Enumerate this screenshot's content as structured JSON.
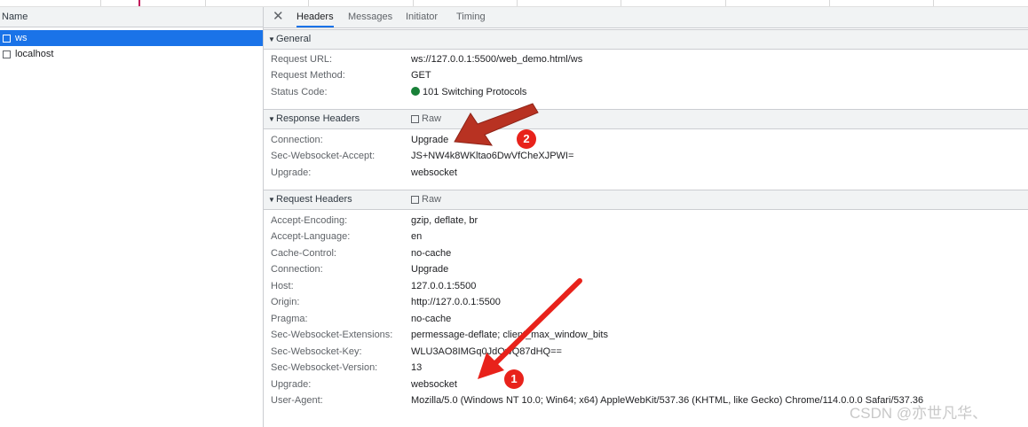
{
  "request_list": {
    "column_header": "Name",
    "items": [
      {
        "name": "ws",
        "selected": true
      },
      {
        "name": "localhost",
        "selected": false
      }
    ]
  },
  "details": {
    "close_icon": "close-icon",
    "tabs": [
      {
        "label": "Headers",
        "active": true
      },
      {
        "label": "Messages",
        "active": false
      },
      {
        "label": "Initiator",
        "active": false
      },
      {
        "label": "Timing",
        "active": false
      }
    ],
    "general": {
      "title": "General",
      "rows": [
        {
          "key": "Request URL:",
          "value": "ws://127.0.0.1:5500/web_demo.html/ws"
        },
        {
          "key": "Request Method:",
          "value": "GET"
        },
        {
          "key": "Status Code:",
          "value": "101 Switching Protocols",
          "status_color": "#188038"
        }
      ]
    },
    "response_headers": {
      "title": "Response Headers",
      "raw_label": "Raw",
      "rows": [
        {
          "key": "Connection:",
          "value": "Upgrade"
        },
        {
          "key": "Sec-Websocket-Accept:",
          "value": "JS+NW4k8WKltao6DwVfCheXJPWI="
        },
        {
          "key": "Upgrade:",
          "value": "websocket"
        }
      ]
    },
    "request_headers": {
      "title": "Request Headers",
      "raw_label": "Raw",
      "rows": [
        {
          "key": "Accept-Encoding:",
          "value": "gzip, deflate, br"
        },
        {
          "key": "Accept-Language:",
          "value": "en"
        },
        {
          "key": "Cache-Control:",
          "value": "no-cache"
        },
        {
          "key": "Connection:",
          "value": "Upgrade"
        },
        {
          "key": "Host:",
          "value": "127.0.0.1:5500"
        },
        {
          "key": "Origin:",
          "value": "http://127.0.0.1:5500"
        },
        {
          "key": "Pragma:",
          "value": "no-cache"
        },
        {
          "key": "Sec-Websocket-Extensions:",
          "value": "permessage-deflate; client_max_window_bits"
        },
        {
          "key": "Sec-Websocket-Key:",
          "value": "WLU3AO8IMGq0JdOwQ87dHQ=="
        },
        {
          "key": "Sec-Websocket-Version:",
          "value": "13"
        },
        {
          "key": "Upgrade:",
          "value": "websocket"
        },
        {
          "key": "User-Agent:",
          "value": "Mozilla/5.0 (Windows NT 10.0; Win64; x64) AppleWebKit/537.36 (KHTML, like Gecko) Chrome/114.0.0.0 Safari/537.36"
        }
      ]
    }
  },
  "annotations": {
    "badge_1": "1",
    "badge_2": "2",
    "arrow_color": "#e8221b",
    "arrow_dark_color": "#b83222"
  },
  "watermark": "CSDN @亦世凡华、"
}
